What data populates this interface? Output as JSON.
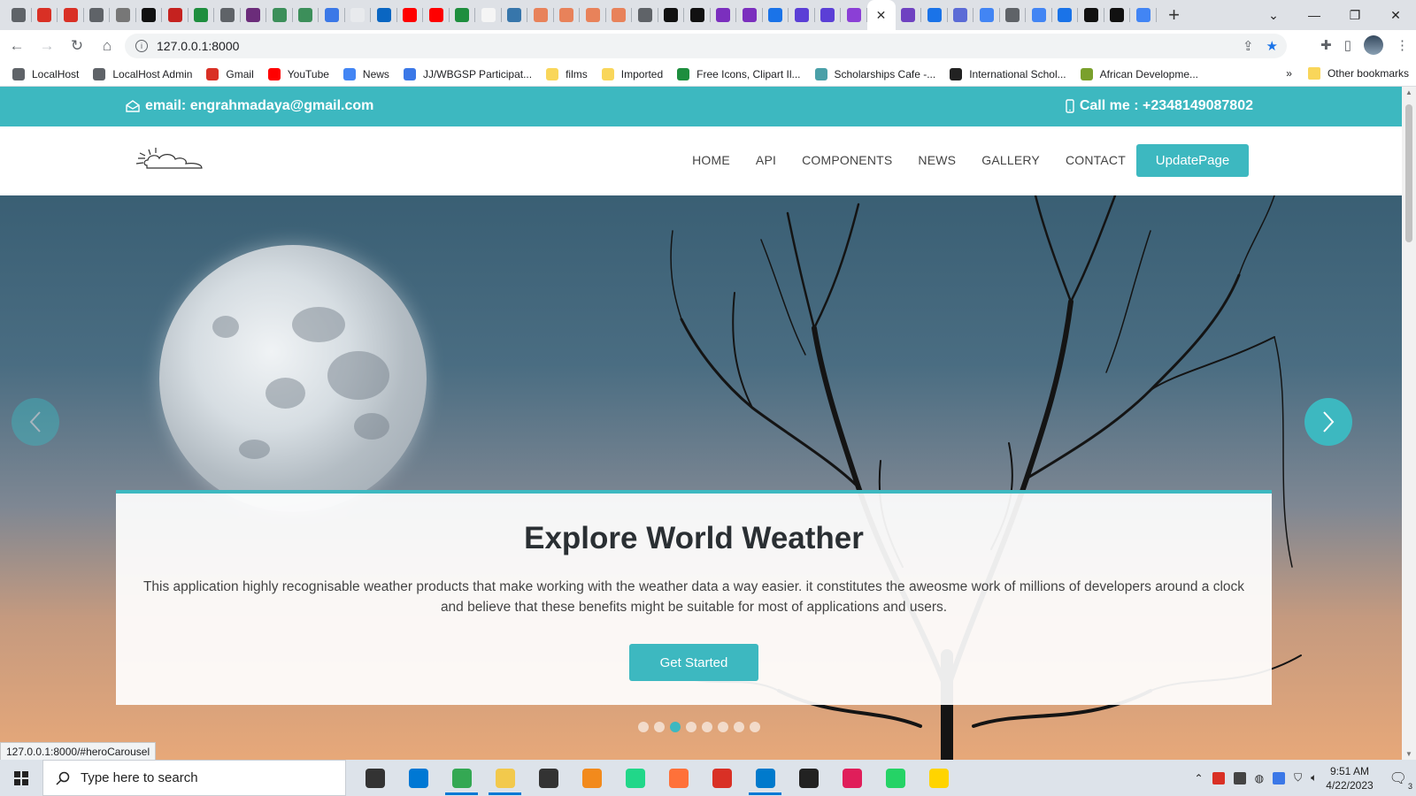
{
  "browser": {
    "tab_favicons": [
      {
        "icon": "localhost-icon",
        "color": "#5f6368"
      },
      {
        "icon": "red-dot-icon",
        "color": "#d93025"
      },
      {
        "icon": "red-dot-icon",
        "color": "#d93025"
      },
      {
        "icon": "localhost-icon",
        "color": "#5f6368"
      },
      {
        "icon": "doc-icon",
        "color": "#777777"
      },
      {
        "icon": "github-icon",
        "color": "#111111"
      },
      {
        "icon": "bars-icon",
        "color": "#c5221f"
      },
      {
        "icon": "green-square-icon",
        "color": "#1e8e3e"
      },
      {
        "icon": "localhost-icon",
        "color": "#5f6368"
      },
      {
        "icon": "u-icon",
        "color": "#6b2c7a"
      },
      {
        "icon": "leaf-icon",
        "color": "#3c8f5a"
      },
      {
        "icon": "leaf-icon",
        "color": "#3c8f5a"
      },
      {
        "icon": "globe-icon",
        "color": "#3b78e7"
      },
      {
        "icon": "blank-icon",
        "color": "#e8eaed"
      },
      {
        "icon": "linkedin-icon",
        "color": "#0a66c2"
      },
      {
        "icon": "youtube-icon",
        "color": "#ff0000"
      },
      {
        "icon": "youtube-icon",
        "color": "#ff0000"
      },
      {
        "icon": "chart-icon",
        "color": "#1e8e3e"
      },
      {
        "icon": "sun-icon",
        "color": "#f5f5f5"
      },
      {
        "icon": "python-icon",
        "color": "#3776ab"
      },
      {
        "icon": "orange-icon",
        "color": "#e8825a"
      },
      {
        "icon": "orange-icon",
        "color": "#e8825a"
      },
      {
        "icon": "orange-icon",
        "color": "#e8825a"
      },
      {
        "icon": "orange-icon",
        "color": "#e8825a"
      },
      {
        "icon": "localhost-icon",
        "color": "#5f6368"
      },
      {
        "icon": "nc-icon",
        "color": "#111111"
      },
      {
        "icon": "nc-icon",
        "color": "#111111"
      },
      {
        "icon": "purple-icon",
        "color": "#7b2fbe"
      },
      {
        "icon": "purple-icon",
        "color": "#7b2fbe"
      },
      {
        "icon": "c-icon",
        "color": "#1a73e8"
      },
      {
        "icon": "u-icon",
        "color": "#5b3fd6"
      },
      {
        "icon": "u-icon",
        "color": "#5b3fd6"
      },
      {
        "icon": "i-icon",
        "color": "#8b3fd6"
      }
    ],
    "tab_favicons_after": [
      {
        "icon": "b-icon",
        "color": "#6f42c1"
      },
      {
        "icon": "refresh-icon",
        "color": "#1a73e8"
      },
      {
        "icon": "hex-icon",
        "color": "#5b6bd6"
      },
      {
        "icon": "google-icon",
        "color": "#4285f4"
      },
      {
        "icon": "code-icon",
        "color": "#5f6368"
      },
      {
        "icon": "google-icon",
        "color": "#4285f4"
      },
      {
        "icon": "flag-icon",
        "color": "#1a73e8"
      },
      {
        "icon": "black-icon",
        "color": "#111111"
      },
      {
        "icon": "black-icon",
        "color": "#111111"
      },
      {
        "icon": "google-icon",
        "color": "#4285f4"
      }
    ],
    "url": "127.0.0.1:8000",
    "bookmarks": [
      {
        "label": "LocalHost",
        "color": "#5f6368"
      },
      {
        "label": "LocalHost Admin",
        "color": "#5f6368"
      },
      {
        "label": "Gmail",
        "color": "#d93025"
      },
      {
        "label": "YouTube",
        "color": "#ff0000"
      },
      {
        "label": "News",
        "color": "#4285f4"
      },
      {
        "label": "JJ/WBGSP Participat...",
        "color": "#3b78e7"
      },
      {
        "label": "films",
        "color": "#f9d65a"
      },
      {
        "label": "Imported",
        "color": "#f9d65a"
      },
      {
        "label": "Free Icons, Clipart Il...",
        "color": "#1e8e3e"
      },
      {
        "label": "Scholarships Cafe -...",
        "color": "#4aa0a8"
      },
      {
        "label": "International Schol...",
        "color": "#222222"
      },
      {
        "label": "African Developme...",
        "color": "#7aa02c"
      }
    ],
    "more_bookmarks": "»",
    "other_bookmarks": "Other bookmarks",
    "status_url": "127.0.0.1:8000/#heroCarousel"
  },
  "site": {
    "accent": "#3db8c0",
    "topbar": {
      "email": "email: engrahmadaya@gmail.com",
      "phone": "Call me : +2348149087802"
    },
    "nav": [
      "HOME",
      "API",
      "COMPONENTS",
      "NEWS",
      "GALLERY",
      "CONTACT"
    ],
    "update_button": "UpdatePage",
    "hero": {
      "title": "Explore World Weather",
      "text": "This application highly recognisable weather products that make working with the weather data a way easier. it constitutes the aweosme work of millions of developers around a clock and believe that these benefits might be suitable for most of applications and users.",
      "cta": "Get Started",
      "slide_count": 8,
      "active_slide": 3
    }
  },
  "taskbar": {
    "search_placeholder": "Type here to search",
    "apps": [
      {
        "icon": "task-view-icon",
        "color": "#333333"
      },
      {
        "icon": "edge-icon",
        "color": "#0078d4"
      },
      {
        "icon": "chrome-icon",
        "color": "#34a853",
        "running": true
      },
      {
        "icon": "file-explorer-icon",
        "color": "#f2c94c",
        "running": true
      },
      {
        "icon": "store-icon",
        "color": "#333333"
      },
      {
        "icon": "sublime-icon",
        "color": "#f28a1c"
      },
      {
        "icon": "pycharm-icon",
        "color": "#21d789"
      },
      {
        "icon": "firefox-icon",
        "color": "#ff7139"
      },
      {
        "icon": "books-icon",
        "color": "#d93025"
      },
      {
        "icon": "vscode-icon",
        "color": "#007acc",
        "running": true
      },
      {
        "icon": "mail-icon",
        "color": "#222222"
      },
      {
        "icon": "slack-icon",
        "color": "#e01e5a"
      },
      {
        "icon": "whatsapp-icon",
        "color": "#25d366"
      },
      {
        "icon": "sticky-icon",
        "color": "#ffd400"
      }
    ],
    "time": "9:51 AM",
    "date": "4/22/2023",
    "notifications": "3"
  }
}
